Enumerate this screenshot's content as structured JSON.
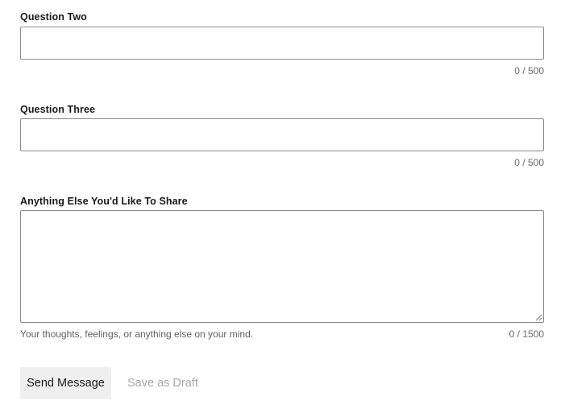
{
  "form": {
    "question_two": {
      "label": "Question Two",
      "value": "",
      "counter": "0 / 500"
    },
    "question_three": {
      "label": "Question Three",
      "value": "",
      "counter": "0 / 500"
    },
    "anything_else": {
      "label": "Anything Else You'd Like To Share",
      "value": "",
      "helper": "Your thoughts, feelings, or anything else on your mind.",
      "counter": "0 / 1500"
    }
  },
  "actions": {
    "send_label": "Send Message",
    "draft_label": "Save as Draft"
  },
  "colors": {
    "border": "#8a8a8a",
    "primary_button_bg": "#efefef",
    "muted_text": "#a8a8a8"
  }
}
